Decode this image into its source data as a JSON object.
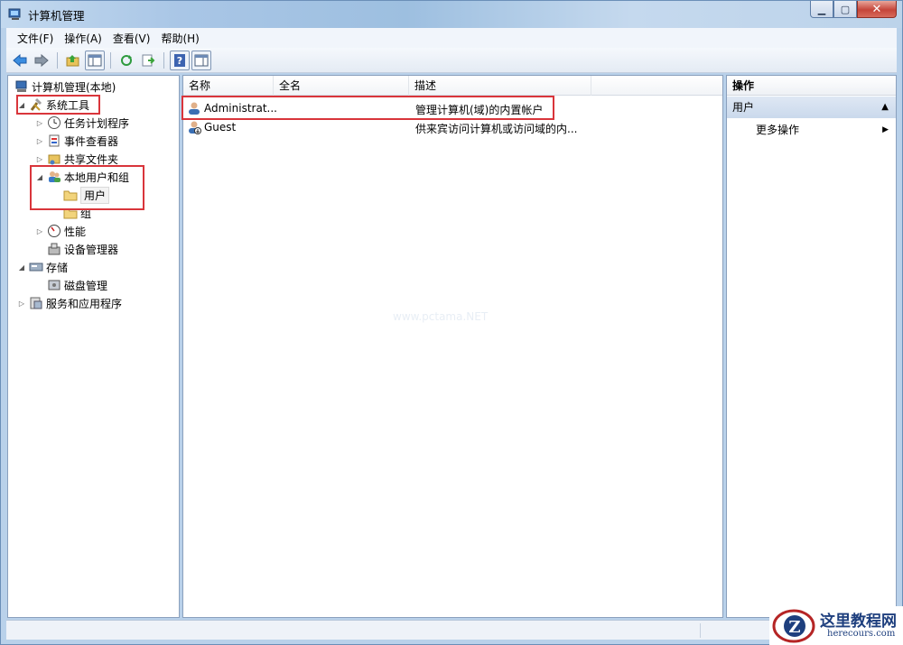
{
  "window": {
    "title": "计算机管理"
  },
  "menu": [
    "文件(F)",
    "操作(A)",
    "查看(V)",
    "帮助(H)"
  ],
  "tree": {
    "root": "计算机管理(本地)",
    "system_tools": "系统工具",
    "task_scheduler": "任务计划程序",
    "event_viewer": "事件查看器",
    "shared_folders": "共享文件夹",
    "local_users_groups": "本地用户和组",
    "users": "用户",
    "groups": "组",
    "performance": "性能",
    "device_manager": "设备管理器",
    "storage": "存储",
    "disk_management": "磁盘管理",
    "services_apps": "服务和应用程序"
  },
  "list": {
    "columns": [
      "名称",
      "全名",
      "描述"
    ],
    "rows": [
      {
        "name": "Administrat...",
        "fullname": "",
        "description": "管理计算机(域)的内置帐户"
      },
      {
        "name": "Guest",
        "fullname": "",
        "description": "供来宾访问计算机或访问域的内..."
      }
    ],
    "watermark": "www.pctama.NET"
  },
  "actions": {
    "header": "操作",
    "section": "用户",
    "more": "更多操作"
  },
  "logo": {
    "name": "这里教程网",
    "url": "herecours.com"
  },
  "colors": {
    "highlight_box": "#d9353b",
    "logo": "#1e3f7e"
  }
}
